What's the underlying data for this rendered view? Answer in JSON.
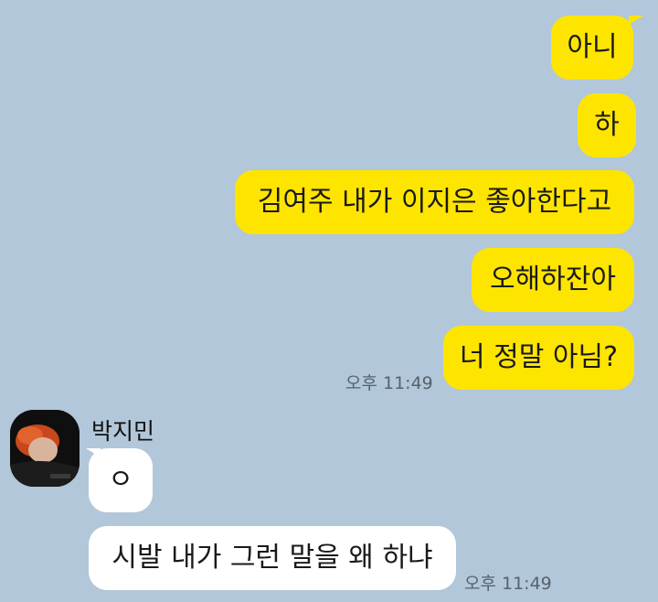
{
  "chat": {
    "outgoing": [
      {
        "text": "아니"
      },
      {
        "text": "하"
      },
      {
        "text": "김여주 내가 이지은 좋아한다고"
      },
      {
        "text": "오해하잔아"
      },
      {
        "text": "너 정말 아님?"
      }
    ],
    "outgoing_time": "오후 11:49",
    "incoming": {
      "sender": "박지민",
      "messages": [
        {
          "text": "ㅇ"
        },
        {
          "text": "시발 내가 그런 말을 왜 하냐"
        }
      ],
      "time": "오후 11:49"
    }
  },
  "colors": {
    "background": "#b2c7d9",
    "outgoing_bubble": "#fee500",
    "incoming_bubble": "#ffffff"
  },
  "icons": {
    "avatar": "profile-photo"
  }
}
